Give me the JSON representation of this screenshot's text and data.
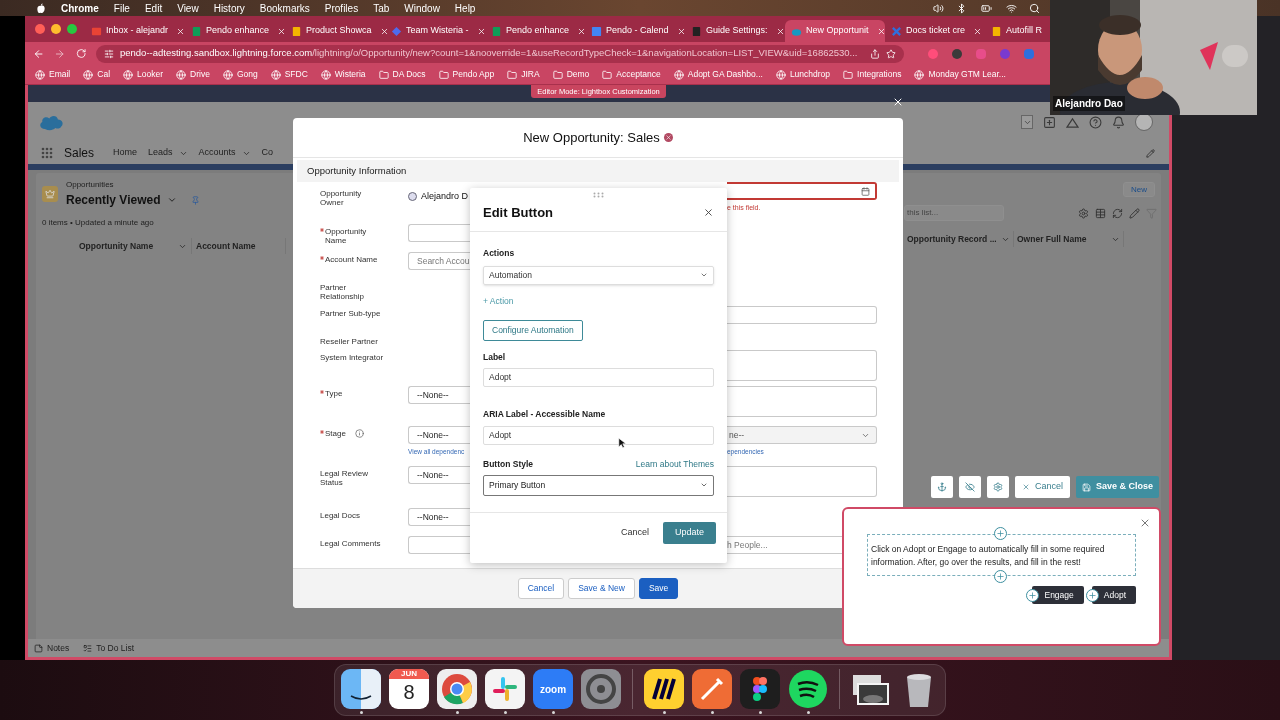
{
  "menu_bar": {
    "app": "Chrome",
    "menus": [
      "File",
      "Edit",
      "View",
      "History",
      "Bookmarks",
      "Profiles",
      "Tab",
      "Window",
      "Help"
    ]
  },
  "browser": {
    "tabs": [
      {
        "title": "Inbox - alejandr",
        "kind": "mail",
        "selected": false
      },
      {
        "title": "Pendo enhance",
        "kind": "sheet",
        "selected": false
      },
      {
        "title": "Product Showca",
        "kind": "slides",
        "selected": false
      },
      {
        "title": "Team Wisteria -",
        "kind": "diamond",
        "selected": false
      },
      {
        "title": "Pendo enhance",
        "kind": "sheet",
        "selected": false
      },
      {
        "title": "Pendo - Calend",
        "kind": "calendar",
        "selected": false
      },
      {
        "title": "Guide Settings:",
        "kind": "book",
        "selected": false
      },
      {
        "title": "New Opportunit",
        "kind": "cloud",
        "selected": true
      },
      {
        "title": "Docs ticket cre",
        "kind": "tool",
        "selected": false
      },
      {
        "title": "Autofill R",
        "kind": "slides",
        "selected": false
      }
    ],
    "url_host": "pendo--adtesting.sandbox.lightning.force.com",
    "url_path": "/lightning/o/Opportunity/new?count=1&nooverride=1&useRecordTypeCheck=1&navigationLocation=LIST_VIEW&uid=16862530...",
    "bookmarks": [
      {
        "label": "Email",
        "kind": "site"
      },
      {
        "label": "Cal",
        "kind": "site"
      },
      {
        "label": "Looker",
        "kind": "site"
      },
      {
        "label": "Drive",
        "kind": "site"
      },
      {
        "label": "Gong",
        "kind": "site"
      },
      {
        "label": "SFDC",
        "kind": "site"
      },
      {
        "label": "Wisteria",
        "kind": "site"
      },
      {
        "label": "DA Docs",
        "kind": "folder"
      },
      {
        "label": "Pendo App",
        "kind": "folder"
      },
      {
        "label": "JIRA",
        "kind": "folder"
      },
      {
        "label": "Demo",
        "kind": "folder"
      },
      {
        "label": "Acceptance",
        "kind": "folder"
      },
      {
        "label": "Adopt GA Dashbo...",
        "kind": "site"
      },
      {
        "label": "Lunchdrop",
        "kind": "site"
      },
      {
        "label": "Integrations",
        "kind": "folder"
      },
      {
        "label": "Monday GTM Lear...",
        "kind": "site"
      }
    ]
  },
  "editor_banner": "Editor Mode: Lightbox Customization",
  "salesforce": {
    "app_name": "Sales",
    "nav": [
      {
        "label": "Home",
        "dropdown": false
      },
      {
        "label": "Leads",
        "dropdown": true
      },
      {
        "label": "Accounts",
        "dropdown": true
      },
      {
        "label": "Co",
        "dropdown": false
      }
    ],
    "list": {
      "object": "Opportunities",
      "view": "Recently Viewed",
      "status": "0 items • Updated a minute ago",
      "new_button": "New",
      "search_placeholder": "this list...",
      "columns_left": [
        "Opportunity Name",
        "Account Name"
      ],
      "columns_right": [
        "Opportunity Record ...",
        "Owner Full Name"
      ]
    },
    "utility_bar": [
      {
        "label": "Notes",
        "kind": "notes"
      },
      {
        "label": "To Do List",
        "kind": "todo"
      }
    ]
  },
  "modal": {
    "title": "New Opportunity: Sales",
    "section": "Opportunity Information",
    "rows": [
      {
        "label": "Opportunity Owner",
        "required": false,
        "kind": "owner",
        "value": "Alejandro D",
        "right": {
          "kind": "date",
          "error": "e this field."
        }
      },
      {
        "label": "Opportunity Name",
        "required": true,
        "kind": "input"
      },
      {
        "label": "Account Name",
        "required": true,
        "kind": "input",
        "placeholder": "Search Accou"
      },
      {
        "label": "Partner Relationship",
        "required": false,
        "kind": "none"
      },
      {
        "label": "Partner Sub-type",
        "required": false,
        "kind": "none",
        "right": {
          "kind": "input"
        }
      },
      {
        "label": "Reseller Partner",
        "required": false,
        "kind": "none"
      },
      {
        "label": "System Integrator",
        "required": false,
        "kind": "none",
        "right": {
          "kind": "textarea"
        }
      },
      {
        "label": "Type",
        "required": true,
        "kind": "select",
        "value": "--None--",
        "right": {
          "kind": "textarea"
        }
      },
      {
        "label": "Stage",
        "required": true,
        "kind": "select",
        "value": "--None--",
        "info": true,
        "link": "View all dependenc",
        "right": {
          "kind": "select",
          "value": "ne--",
          "link": "ependencies"
        }
      },
      {
        "label": "Legal Review Status",
        "required": false,
        "kind": "select",
        "value": "--None--",
        "right": {
          "kind": "textarea"
        }
      },
      {
        "label": "Legal Docs",
        "required": false,
        "kind": "select",
        "value": "--None--"
      },
      {
        "label": "Legal Comments",
        "required": false,
        "kind": "input",
        "right": {
          "kind": "lookup",
          "placeholder": "h People..."
        }
      }
    ],
    "buttons": [
      {
        "label": "Cancel",
        "kind": "neutral"
      },
      {
        "label": "Save & New",
        "kind": "neutral"
      },
      {
        "label": "Save",
        "kind": "brand"
      }
    ]
  },
  "edit_button_dialog": {
    "title": "Edit Button",
    "actions_label": "Actions",
    "action_value": "Automation",
    "add_action": "+ Action",
    "configure_button": "Configure Automation",
    "label_label": "Label",
    "label_value": "Adopt",
    "aria_label": "ARIA Label - Accessible Name",
    "aria_value": "Adopt",
    "style_label": "Button Style",
    "themes_link": "Learn about Themes",
    "style_value": "Primary Button",
    "cancel": "Cancel",
    "update": "Update"
  },
  "pendo_toolbar": {
    "cancel": "Cancel",
    "save": "Save & Close"
  },
  "guide": {
    "text": "Click on Adopt or Engage to automatically fill in some required information. After, go over the results, and fill in the rest!",
    "buttons": [
      "Engage",
      "Adopt"
    ]
  },
  "webcam": {
    "name": "Alejandro Dao"
  },
  "dock": {
    "apps": [
      {
        "kind": "finder",
        "running": true
      },
      {
        "kind": "calendar",
        "month": "JUN",
        "day": "8",
        "running": false
      },
      {
        "kind": "browser",
        "running": true
      },
      {
        "kind": "chat",
        "running": true
      },
      {
        "kind": "video",
        "logo": "zoom",
        "running": true
      },
      {
        "kind": "settings",
        "running": false
      },
      {
        "kind": "divider"
      },
      {
        "kind": "whiteboard",
        "running": true
      },
      {
        "kind": "rocket",
        "running": true
      },
      {
        "kind": "design",
        "running": true
      },
      {
        "kind": "music",
        "running": true
      },
      {
        "kind": "divider"
      },
      {
        "kind": "thumbnail",
        "running": false
      },
      {
        "kind": "trash",
        "running": false
      }
    ]
  }
}
